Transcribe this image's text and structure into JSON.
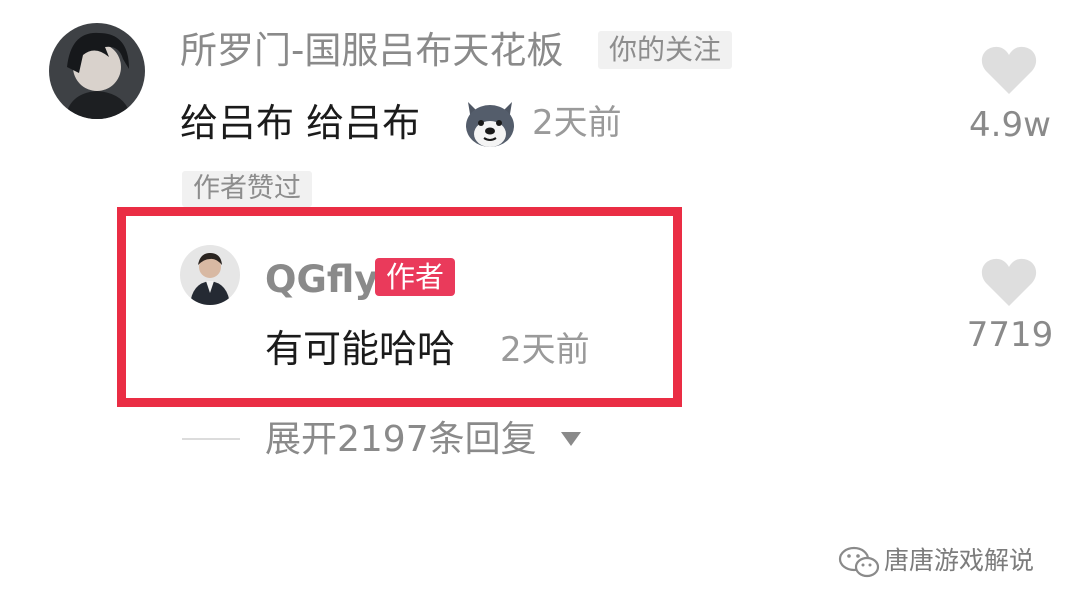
{
  "comment": {
    "username": "所罗门-国服吕布天花板",
    "follow_tag": "你的关注",
    "text": "给吕布 给吕布",
    "emoji_icon": "husky-dog-emoji-icon",
    "time": "2天前",
    "liked_by_author_tag": "作者赞过",
    "like_count": "4.9w"
  },
  "reply": {
    "username": "QGfly",
    "author_badge": "作者",
    "text": "有可能哈哈",
    "time": "2天前",
    "like_count": "7719"
  },
  "expand_replies": {
    "label": "展开2197条回复",
    "icon": "triangle-down-icon"
  },
  "watermark": {
    "icon": "wechat-icon",
    "text": "唐唐游戏解说"
  },
  "colors": {
    "highlight_border": "#ea2d44",
    "author_badge_bg": "#ea3a5b",
    "heart": "#dedede"
  }
}
